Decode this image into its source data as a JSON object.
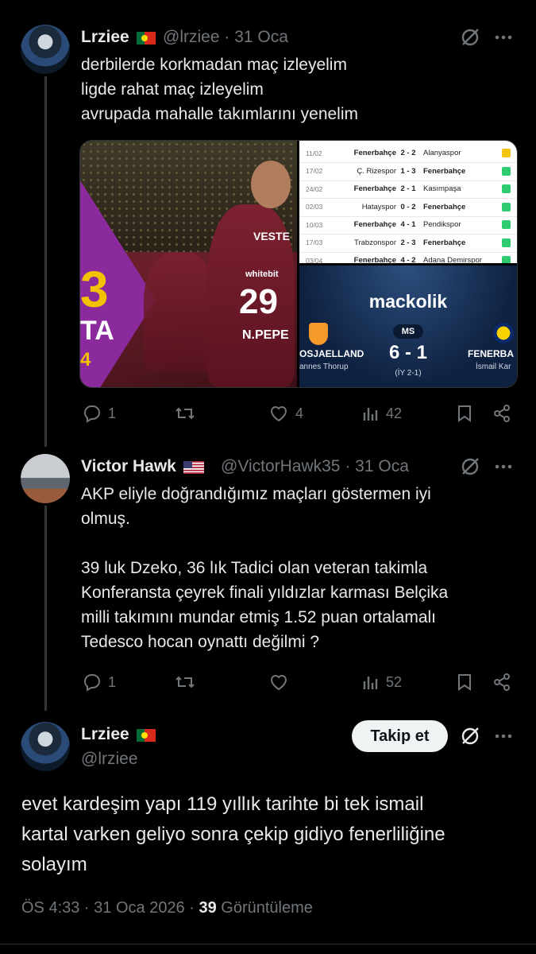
{
  "tweet1": {
    "display_name": "Lrziee",
    "handle": "@lrziee",
    "date": "31 Oca",
    "text": "derbilerde korkmadan maç izleyelim\nligde rahat maç izleyelim\navrupada mahalle takımlarını yenelim",
    "replies": "1",
    "likes": "4",
    "views": "42",
    "media": {
      "left_number": "3",
      "left_text_1": "TA",
      "left_text_2": "4",
      "shirt_number": "29",
      "shirt_name": "N.PEPE",
      "shirt_sponsor": "VESTE",
      "shirt_sponsor_2": "whitebit",
      "fixtures": [
        {
          "date": "11/02",
          "home": "Fenerbahçe",
          "score": "2 - 2",
          "away": "Alanyaspor",
          "result": "draw"
        },
        {
          "date": "17/02",
          "home": "Ç. Rizespor",
          "score": "1 - 3",
          "away": "Fenerbahçe",
          "result": "win"
        },
        {
          "date": "24/02",
          "home": "Fenerbahçe",
          "score": "2 - 1",
          "away": "Kasımpaşa",
          "result": "win"
        },
        {
          "date": "02/03",
          "home": "Hatayspor",
          "score": "0 - 2",
          "away": "Fenerbahçe",
          "result": "win"
        },
        {
          "date": "10/03",
          "home": "Fenerbahçe",
          "score": "4 - 1",
          "away": "Pendikspor",
          "result": "win"
        },
        {
          "date": "17/03",
          "home": "Trabzonspor",
          "score": "2 - 3",
          "away": "Fenerbahçe",
          "result": "win"
        },
        {
          "date": "03/04",
          "home": "Fenerbahçe",
          "score": "4 - 2",
          "away": "Adana Demirspor",
          "result": "win"
        }
      ],
      "scorecard": {
        "brand": "mackolik",
        "status": "MS",
        "result": "6 - 1",
        "half_time": "(İY 2-1)",
        "home_team": "OSJAELLAND",
        "home_scorer": "annes Thorup",
        "away_team": "FENERBA",
        "away_scorer": "İsmail Kar"
      }
    }
  },
  "tweet2": {
    "display_name": "Victor Hawk",
    "handle": "@VictorHawk35",
    "date": "31 Oca",
    "text": "AKP eliyle doğrandığımız maçları göstermen iyi\nolmuş.\n\n39 luk Dzeko, 36 lık Tadici olan veteran takimla\nKonferansta çeyrek finali yıldızlar karması Belçika\nmilli takımını mundar etmiş 1.52 puan ortalamalı\nTedesco hocan oynattı değilmi ?",
    "replies": "1",
    "views": "52"
  },
  "main": {
    "display_name": "Lrziee",
    "handle": "@lrziee",
    "follow_label": "Takip et",
    "text": "evet kardeşim yapı 119 yıllık tarihte bi tek ismail\nkartal varken geliyo sonra çekip gidiyo fenerliliğine\nsolayım",
    "time": "ÖS 4:33 · 31 Oca 2026 · ",
    "views_count": "39",
    "views_label": "Görüntüleme"
  },
  "colors": {
    "background": "#000000",
    "text_primary": "#e7e9ea",
    "text_secondary": "#71767b",
    "follow_bg": "#eff3f4",
    "check_green": "#2ecc71",
    "check_yellow": "#f1c40f"
  }
}
